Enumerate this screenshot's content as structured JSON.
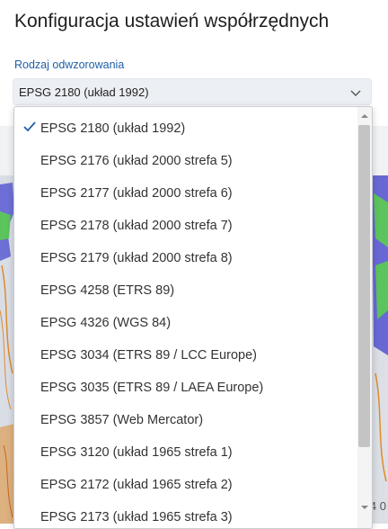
{
  "title": "Konfiguracja ustawień współrzędnych",
  "field": {
    "label": "Rodzaj odwzorowania",
    "selected": "EPSG 2180 (układ 1992)"
  },
  "dropdown": {
    "options": [
      {
        "label": "EPSG 2180 (układ 1992)",
        "selected": true
      },
      {
        "label": "EPSG 2176 (układ 2000 strefa 5)"
      },
      {
        "label": "EPSG 2177 (układ 2000 strefa 6)"
      },
      {
        "label": "EPSG 2178 (układ 2000 strefa 7)"
      },
      {
        "label": "EPSG 2179 (układ 2000 strefa 8)"
      },
      {
        "label": "EPSG 4258 (ETRS 89)"
      },
      {
        "label": "EPSG 4326 (WGS 84)"
      },
      {
        "label": "EPSG 3034 (ETRS 89 / LCC Europe)"
      },
      {
        "label": "EPSG 3035 (ETRS 89 / LAEA Europe)"
      },
      {
        "label": "EPSG 3857 (Web Mercator)"
      },
      {
        "label": "EPSG 3120 (układ 1965 strefa 1)"
      },
      {
        "label": "EPSG 2172 (układ 1965 strefa 2)"
      },
      {
        "label": "EPSG 2173 (układ 1965 strefa 3)"
      }
    ]
  },
  "map": {
    "partial_label": "4 0"
  },
  "colors": {
    "accent": "#1f5fa8",
    "check": "#1f5fa8",
    "map_green": "#5cc45c",
    "map_blue": "#4a4ad0",
    "map_orange": "#e08a2a"
  }
}
